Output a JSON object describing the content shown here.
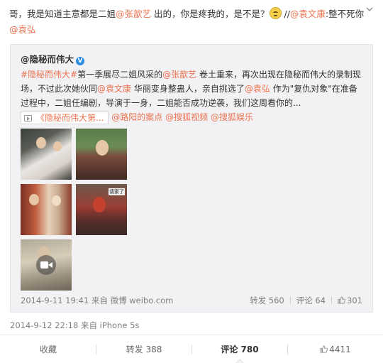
{
  "post": {
    "text_1": "哥，我是知道主意都是二姐",
    "mention_1": "@张歆艺",
    "text_2": " 出的，你是疼我的，是不是？",
    "text_3": " //",
    "mention_2": "@袁文康",
    "text_4": ":整不死你",
    "mention_3": "@袁弘",
    "emoji": "confused-emoji"
  },
  "repost": {
    "author": "@隐秘而伟大",
    "verified": "V",
    "hashtag": "#隐秘而伟大#",
    "t1": "第一季展尽二姐风采的",
    "mention_a": "@张歆艺",
    "t2": " 卷土重来，再次出现在隐秘而伟大的录制现场，不过此次她伙同",
    "mention_b": "@袁文康",
    "t3": " 华丽变身整蛊人，亲自挑选了",
    "mention_c": "@袁弘",
    "t4": " 作为\"复仇对象\"在准备过程中，二姐任编剧，导演于一身，二姐能否成功逆袭，我们这周看你的...",
    "attachment_title": "《隐秘而伟大第...",
    "tags": [
      "@路阳的案点",
      "@搜狐视频",
      "@搜狐娱乐"
    ],
    "timestamp": "2014-9-11 19:41",
    "source": "来自 微博 weibo.com",
    "forward_label": "转发 560",
    "comment_label": "评论 64",
    "like_count": "301",
    "thumbnails": [
      "image-1",
      "image-2",
      "image-3",
      "image-4",
      "video-thumbnail"
    ],
    "thumb_caption": "请家了"
  },
  "meta": {
    "timestamp": "2014-9-12 22:18",
    "source": "来自 iPhone 5s"
  },
  "bottom_bar": {
    "collect": "收藏",
    "forward": "转发 388",
    "comment": "评论 780",
    "like": "4411"
  },
  "colors": {
    "link": "#eb7350",
    "blue_link": "#2b6fb3",
    "repost_bg": "#f2f2f5",
    "verified": "#2f8de0"
  }
}
